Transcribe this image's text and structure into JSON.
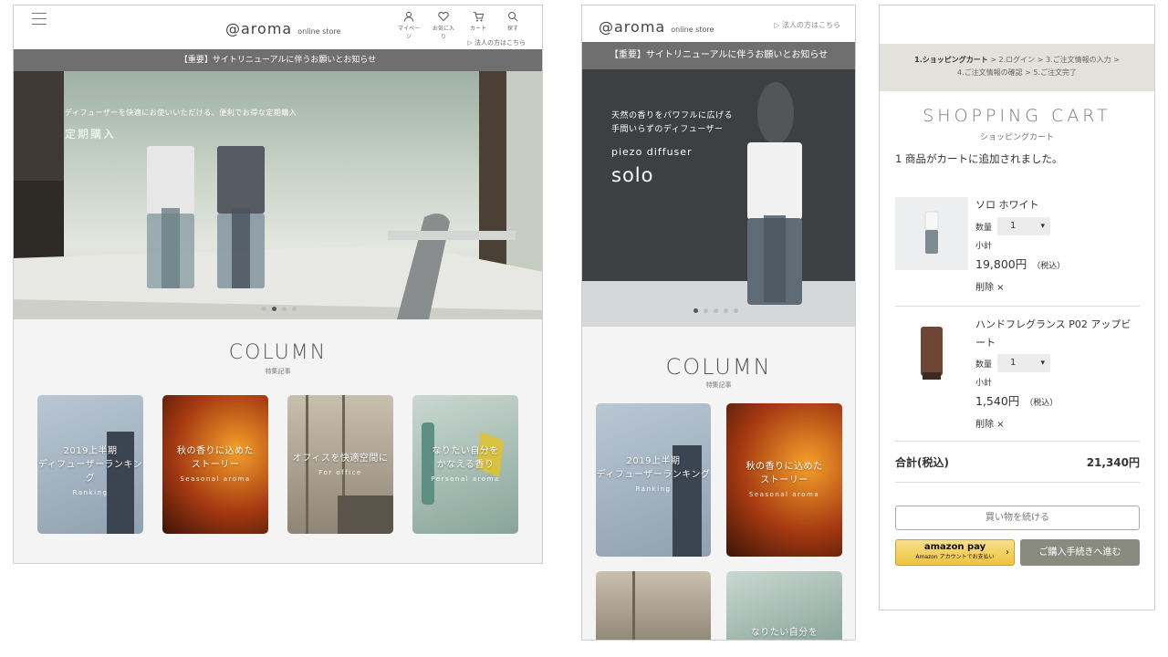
{
  "colors": {
    "notice_bg": "#6f6f6f",
    "steps_bg": "#e3e1dc",
    "buy_button": "#8a8b80",
    "amazon": "#f0c33e"
  },
  "desktop": {
    "logo": "@aroma",
    "logo_sub": "online store",
    "nav": [
      {
        "icon": "user-icon",
        "label": "マイページ"
      },
      {
        "icon": "heart-icon",
        "label": "お気に入り"
      },
      {
        "icon": "cart-icon",
        "label": "カート"
      },
      {
        "icon": "search-icon",
        "label": "探す"
      }
    ],
    "business_link": "法人の方はこちら",
    "notice": "【重要】サイトリニューアルに伴うお願いとお知らせ",
    "hero_lead": "ディフューザーを快適にお使いいただける、便利でお得な定期購入",
    "hero_title": "定期購入",
    "carousel": {
      "count": 4,
      "active": 2
    },
    "column_title": "COLUMN",
    "column_sub": "特集記事",
    "cards": [
      {
        "title1": "2019上半期",
        "title2": "ディフューザーランキング",
        "sub": "Ranking"
      },
      {
        "title1": "秋の香りに込めた",
        "title2": "ストーリー",
        "sub": "Seasonal aroma"
      },
      {
        "title1": "オフィスを快適空間に",
        "title2": "",
        "sub": "For office"
      },
      {
        "title1": "なりたい自分を",
        "title2": "かなえる香り",
        "sub": "Personal aroma"
      }
    ]
  },
  "mobile": {
    "logo": "@aroma",
    "logo_sub": "online store",
    "business_link": "法人の方はこちら",
    "notice": "【重要】サイトリニューアルに伴うお願いとお知らせ",
    "hero_lead1": "天然の香りをパワフルに広げる",
    "hero_lead2": "手間いらずのディフューザー",
    "hero_sub": "piezo diffuser",
    "hero_title": "solo",
    "carousel": {
      "count": 5,
      "active": 1
    },
    "column_title": "COLUMN",
    "column_sub": "特集記事",
    "cards": [
      {
        "title1": "2019上半期",
        "title2": "ディフューザーランキング",
        "sub": "Ranking"
      },
      {
        "title1": "秋の香りに込めた",
        "title2": "ストーリー",
        "sub": "Seasonal aroma"
      },
      {
        "title1": "",
        "title2": "",
        "sub": ""
      },
      {
        "title1": "なりたい自分を",
        "title2": "",
        "sub": ""
      }
    ]
  },
  "cart": {
    "steps": [
      "1.ショッピングカート",
      "2.ログイン",
      "3.ご注文情報の入力",
      "4.ご注文情報の確認",
      "5.ご注文完了"
    ],
    "title": "SHOPPING CART",
    "title_sub": "ショッピングカート",
    "message": "1 商品がカートに追加されました。",
    "qty_label": "数量",
    "subtotal_label": "小計",
    "tax_note": "（税込）",
    "delete_label": "削除 ×",
    "items": [
      {
        "name": "ソロ ホワイト",
        "qty": "1",
        "price": "19,800円"
      },
      {
        "name": "ハンドフレグランス P02 アップビート",
        "qty": "1",
        "price": "1,540円"
      }
    ],
    "total_label": "合計(税込)",
    "total_value": "21,340円",
    "continue_label": "買い物を続ける",
    "amazon_label": "amazon pay",
    "amazon_sub": "Amazon アカウントでお支払い",
    "checkout_label": "ご購入手続きへ進む"
  }
}
